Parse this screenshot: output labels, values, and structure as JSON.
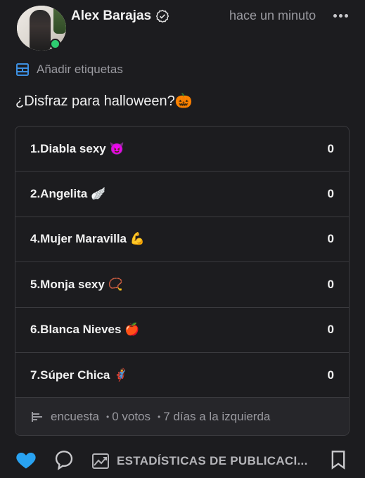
{
  "post": {
    "author": "Alex Barajas",
    "time": "hace un minuto",
    "add_tags_label": "Añadir etiquetas",
    "question": "¿Disfraz para halloween?🎃"
  },
  "poll": {
    "options": [
      {
        "label": "1.Diabla sexy 😈",
        "count": "0"
      },
      {
        "label": "2.Angelita 🪽",
        "count": "0"
      },
      {
        "label": "4.Mujer Maravilla 💪",
        "count": "0"
      },
      {
        "label": "5.Monja sexy 📿",
        "count": "0"
      },
      {
        "label": "6.Blanca Nieves 🍎",
        "count": "0"
      },
      {
        "label": "7.Súper Chica 🦸",
        "count": "0"
      }
    ],
    "footer": {
      "type": "encuesta",
      "sep1": "•",
      "votes": "0 votos",
      "sep2": "•",
      "remaining": "7 días a la izquierda"
    }
  },
  "actions": {
    "stats_label": "ESTADÍSTICAS DE PUBLICACI..."
  },
  "colors": {
    "background": "#1c1c1f",
    "like": "#29a3f2",
    "online": "#2ecc71"
  }
}
